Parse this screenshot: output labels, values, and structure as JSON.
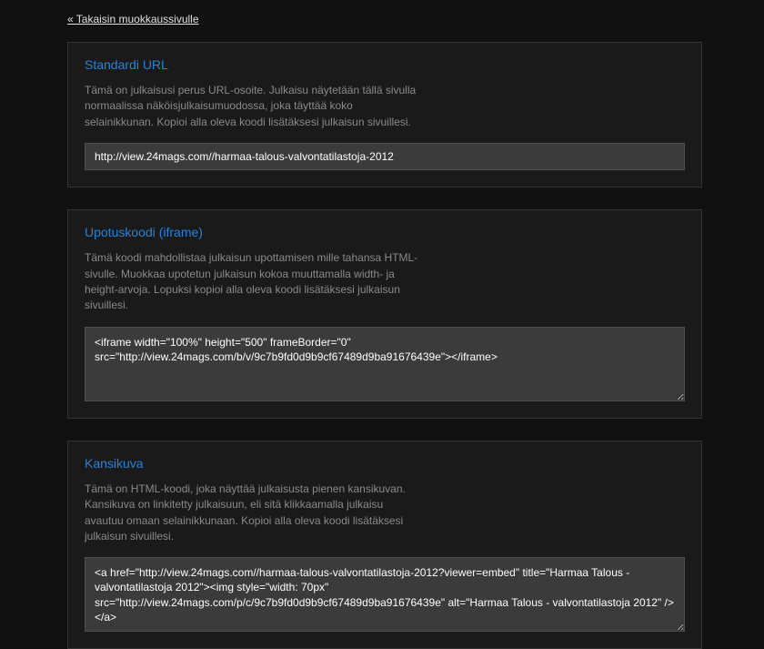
{
  "back_link": "« Takaisin muokkaussivulle",
  "sections": {
    "standard": {
      "title": "Standardi URL",
      "desc": "Tämä on julkaisusi perus URL-osoite. Julkaisu näytetään tällä sivulla normaalissa näköisjulkaisumuodossa, joka täyttää koko selainikkunan. Kopioi alla oleva koodi lisätäksesi julkaisun sivuillesi.",
      "value": "http://view.24mags.com//harmaa-talous-valvontatilastoja-2012"
    },
    "iframe": {
      "title": "Upotuskoodi (iframe)",
      "desc": "Tämä koodi mahdollistaa julkaisun upottamisen mille tahansa HTML-sivulle. Muokkaa upotetun julkaisun kokoa muuttamalla width- ja height-arvoja. Lopuksi kopioi alla oleva koodi lisätäksesi julkaisun sivuillesi.",
      "value": "<iframe width=\"100%\" height=\"500\" frameBorder=\"0\" src=\"http://view.24mags.com/b/v/9c7b9fd0d9b9cf67489d9ba91676439e\"></iframe>"
    },
    "cover": {
      "title": "Kansikuva",
      "desc": "Tämä on HTML-koodi, joka näyttää julkaisusta pienen kansikuvan. Kansikuva on linkitetty julkaisuun, eli sitä klikkaamalla julkaisu avautuu omaan selainikkunaan. Kopioi alla oleva koodi lisätäksesi julkaisun sivuillesi.",
      "value": "<a href=\"http://view.24mags.com//harmaa-talous-valvontatilastoja-2012?viewer=embed\" title=\"Harmaa Talous - valvontatilastoja 2012\"><img style=\"width: 70px\" src=\"http://view.24mags.com/p/c/9c7b9fd0d9b9cf67489d9ba91676439e\" alt=\"Harmaa Talous - valvontatilastoja 2012\" /></a>"
    }
  }
}
